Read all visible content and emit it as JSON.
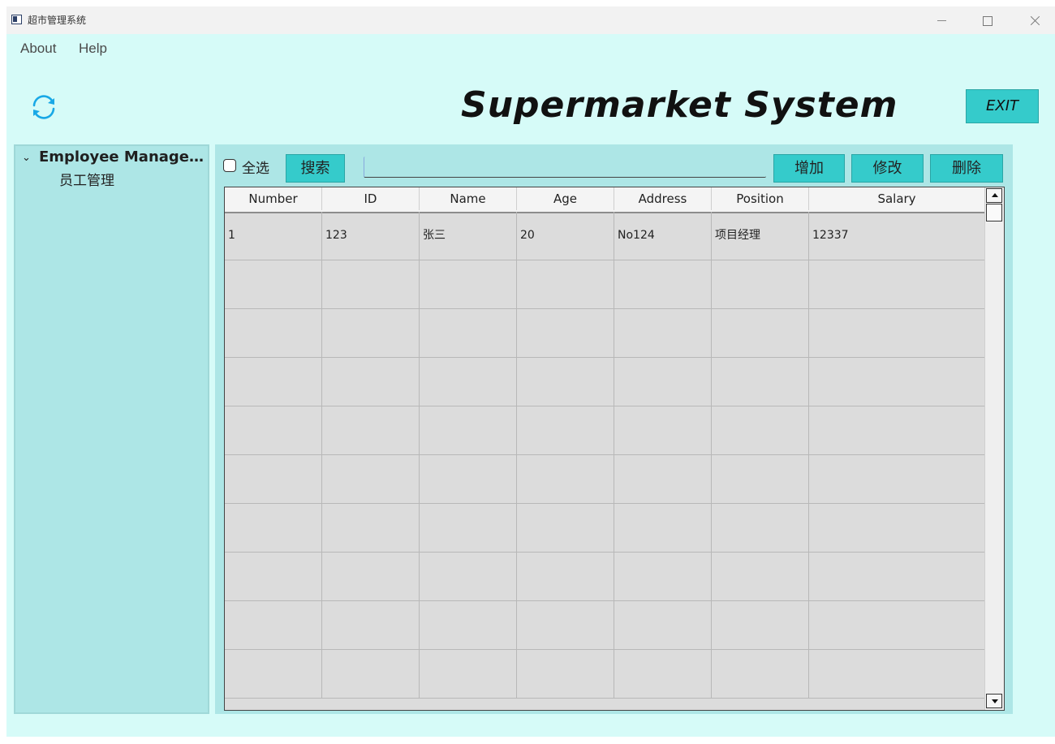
{
  "window": {
    "title": "超市管理系统"
  },
  "menu": {
    "about": "About",
    "help": "Help"
  },
  "header": {
    "title": "Supermarket System",
    "exit_label": "EXIT"
  },
  "sidebar": {
    "parent_label": "Employee Managem...",
    "child_label": "员工管理"
  },
  "toolbar": {
    "select_all_label": "全选",
    "search_label": "搜索",
    "search_value": "",
    "add_label": "增加",
    "edit_label": "修改",
    "delete_label": "删除"
  },
  "table": {
    "columns": [
      "Number",
      "ID",
      "Name",
      "Age",
      "Address",
      "Position",
      "Salary"
    ],
    "rows": [
      [
        "1",
        "123",
        "张三",
        "20",
        "No124",
        "项目经理",
        "12337"
      ],
      [
        "",
        "",
        "",
        "",
        "",
        "",
        ""
      ],
      [
        "",
        "",
        "",
        "",
        "",
        "",
        ""
      ],
      [
        "",
        "",
        "",
        "",
        "",
        "",
        ""
      ],
      [
        "",
        "",
        "",
        "",
        "",
        "",
        ""
      ],
      [
        "",
        "",
        "",
        "",
        "",
        "",
        ""
      ],
      [
        "",
        "",
        "",
        "",
        "",
        "",
        ""
      ],
      [
        "",
        "",
        "",
        "",
        "",
        "",
        ""
      ],
      [
        "",
        "",
        "",
        "",
        "",
        "",
        ""
      ],
      [
        "",
        "",
        "",
        "",
        "",
        "",
        ""
      ]
    ]
  },
  "colors": {
    "background": "#d6fbf8",
    "panel": "#ade6e6",
    "accent_button": "#35cbcb",
    "refresh_icon": "#19a8e6"
  },
  "icons": {
    "app": "window-icon",
    "refresh": "refresh-icon",
    "expand": "chevron-down-icon"
  }
}
